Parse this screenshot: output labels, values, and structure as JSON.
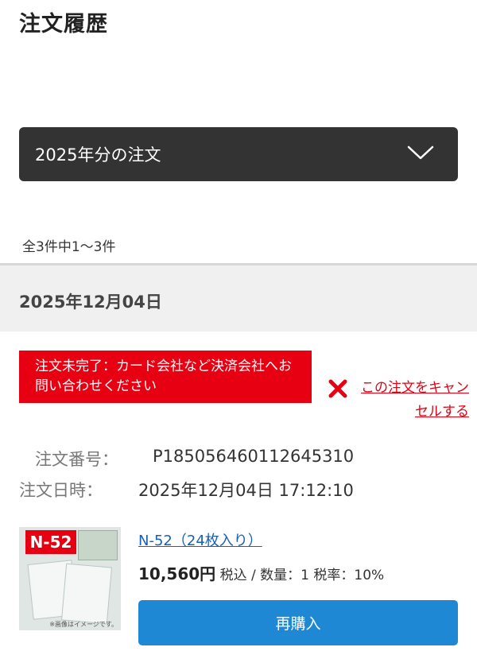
{
  "page": {
    "title": "注文履歴"
  },
  "year_filter": {
    "selected": "2025年分の注文",
    "icon": "chevron-down-icon"
  },
  "result_count": "全3件中1～3件",
  "order": {
    "date_heading": "2025年12月04日",
    "status": "注文未完了：カード会社など決済会社へお問い合わせください",
    "cancel_link": "この注文をキャンセルする",
    "number_label": "注文番号：",
    "number_value": "P185056460112645310",
    "datetime_label": "注文日時：",
    "datetime_value": "2025年12月04日 17:12:10",
    "product": {
      "thumb_tag": "N-52",
      "thumb_caption": "※画像はイメージです。",
      "name": "N-52（24枚入り）",
      "price": "10,560円",
      "tax_label": "税込",
      "quantity": "数量：1",
      "tax_rate": "税率：10%"
    },
    "rebuy_label": "再購入"
  },
  "colors": {
    "accent_red": "#e60012",
    "button_blue": "#1e88d4",
    "link_blue": "#1a5fb4",
    "select_dark": "#333333"
  }
}
